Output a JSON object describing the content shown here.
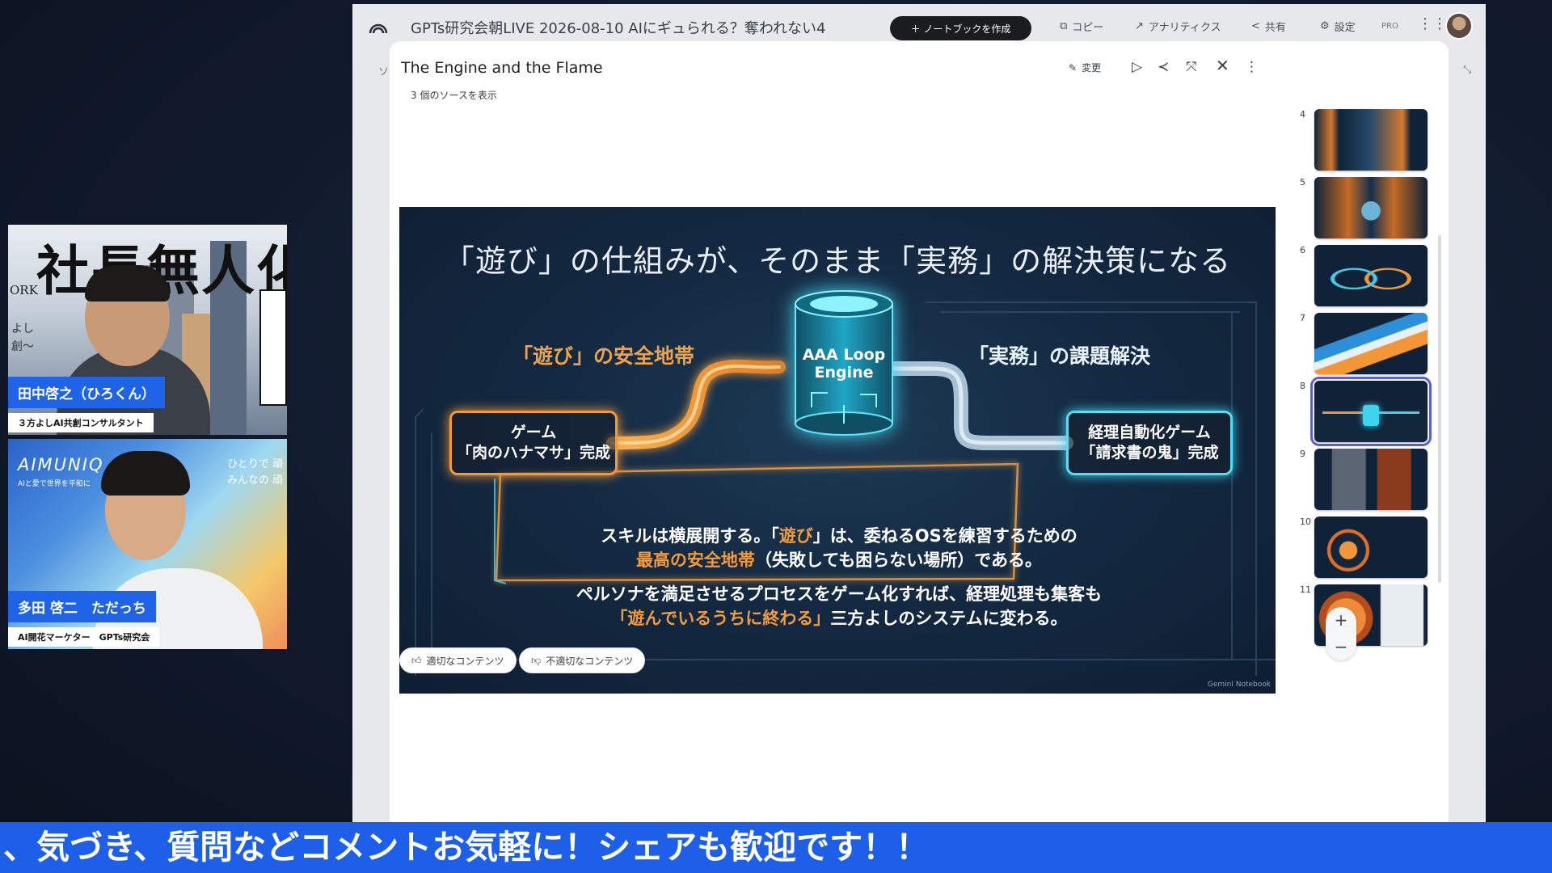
{
  "participants": [
    {
      "name": "田中啓之（ひろくん）",
      "role": "３方よしAI共創コンサルタント",
      "background_title": "社長無人化",
      "background_york": "ORK",
      "background_note": "よし\n創〜"
    },
    {
      "name": "多田 啓二　ただっち",
      "role": "AI開花マーケター　GPTs研究会",
      "background_brand": "AIMUNIQ",
      "background_brand_sub": "AIと愛で世界を平和に",
      "background_tagline": "ひとりで 頑\nみんなの 頑"
    }
  ],
  "app": {
    "notebook_title": "GPTs研究会朝LIVE 2026-08-10 AIにギュられる？奪われない4",
    "create_notebook_button": "＋ ノートブックを作成",
    "copy_label": "コピー",
    "analytics_label": "アナリティクス",
    "share_label": "共有",
    "settings_label": "設定",
    "plan_badge": "PRO"
  },
  "viewer": {
    "title": "The Engine and the Flame",
    "sources_link": "3 個のソースを表示",
    "edit_label": "変更",
    "feedback_good": "適切なコンテンツ",
    "feedback_bad": "不適切なコンテンツ",
    "zoom_in": "+",
    "zoom_out": "−"
  },
  "slide": {
    "title": "「遊び」の仕組みが、そのまま「実務」の解決策になる",
    "left_heading": "「遊び」の安全地帯",
    "right_heading": "「実務」の課題解決",
    "left_box_line1": "ゲーム",
    "left_box_line2": "「肉のハナマサ」完成",
    "right_box_line1": "経理自動化ゲーム",
    "right_box_line2": "「請求書の鬼」完成",
    "engine_line1": "AAA Loop",
    "engine_line2": "Engine",
    "message_p1_a": "スキルは横展開する。「",
    "message_p1_b": "遊び",
    "message_p1_c": "」は、委ねるOSを練習するための",
    "message_p1_d": "最高の安全地帯",
    "message_p1_e": "（失敗しても困らない場所）である。",
    "message_p2_a": "ペルソナを満足させるプロセスをゲーム化すれば、経理処理も集客も",
    "message_p2_b": "「遊んでいるうちに終わる」",
    "message_p2_c": "三方よしのシステムに変わる。",
    "watermark": "Gemini Notebook",
    "accent_orange": "#f29b3c",
    "accent_cyan": "#3fd3ee"
  },
  "thumbnails": [
    {
      "number": "4",
      "active": false
    },
    {
      "number": "5",
      "active": false
    },
    {
      "number": "6",
      "active": false
    },
    {
      "number": "7",
      "active": false
    },
    {
      "number": "8",
      "active": true
    },
    {
      "number": "9",
      "active": false
    },
    {
      "number": "10",
      "active": false
    },
    {
      "number": "11",
      "active": false
    }
  ],
  "ticker_text": "、気づき、質問などコメントお気軽に！シェアも歓迎です！！"
}
